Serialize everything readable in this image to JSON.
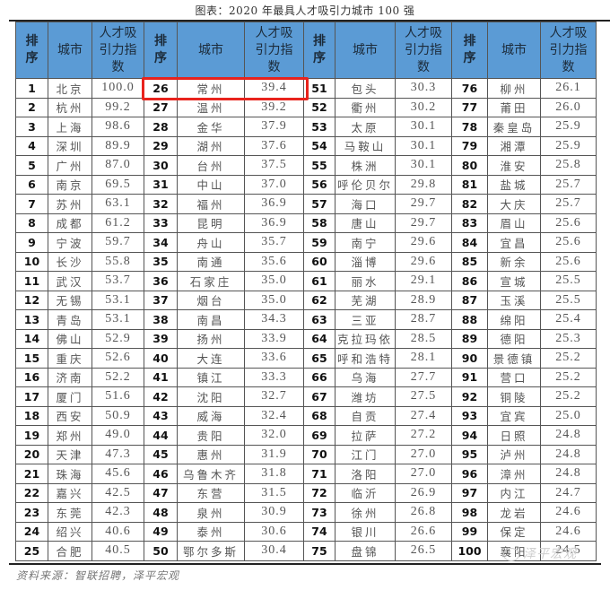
{
  "title": "图表：2020 年最具人才吸引力城市 100 强",
  "headers": {
    "rank": "排序",
    "city": "城市",
    "index": "人才吸引力指数"
  },
  "highlight_rank": 26,
  "highlight_color": "#e8231d",
  "header_color": "#5b9bd5",
  "rows": [
    [
      [
        "1",
        "北京",
        "100.0"
      ],
      [
        "26",
        "常州",
        "39.4"
      ],
      [
        "51",
        "包头",
        "30.3"
      ],
      [
        "76",
        "柳州",
        "26.1"
      ]
    ],
    [
      [
        "2",
        "杭州",
        "99.2"
      ],
      [
        "27",
        "温州",
        "39.2"
      ],
      [
        "52",
        "衢州",
        "30.2"
      ],
      [
        "77",
        "莆田",
        "26.0"
      ]
    ],
    [
      [
        "3",
        "上海",
        "98.6"
      ],
      [
        "28",
        "金华",
        "37.9"
      ],
      [
        "53",
        "太原",
        "30.1"
      ],
      [
        "78",
        "秦皇岛",
        "25.9"
      ]
    ],
    [
      [
        "4",
        "深圳",
        "89.9"
      ],
      [
        "29",
        "湖州",
        "37.6"
      ],
      [
        "54",
        "马鞍山",
        "30.1"
      ],
      [
        "79",
        "湘潭",
        "25.9"
      ]
    ],
    [
      [
        "5",
        "广州",
        "87.0"
      ],
      [
        "30",
        "台州",
        "37.5"
      ],
      [
        "55",
        "株洲",
        "30.1"
      ],
      [
        "80",
        "淮安",
        "25.8"
      ]
    ],
    [
      [
        "6",
        "南京",
        "69.5"
      ],
      [
        "31",
        "中山",
        "37.0"
      ],
      [
        "56",
        "呼伦贝尔",
        "29.8"
      ],
      [
        "81",
        "盐城",
        "25.7"
      ]
    ],
    [
      [
        "7",
        "苏州",
        "63.1"
      ],
      [
        "32",
        "福州",
        "36.9"
      ],
      [
        "57",
        "海口",
        "29.7"
      ],
      [
        "82",
        "大庆",
        "25.7"
      ]
    ],
    [
      [
        "8",
        "成都",
        "61.2"
      ],
      [
        "33",
        "昆明",
        "36.9"
      ],
      [
        "58",
        "唐山",
        "29.7"
      ],
      [
        "83",
        "眉山",
        "25.6"
      ]
    ],
    [
      [
        "9",
        "宁波",
        "59.7"
      ],
      [
        "34",
        "舟山",
        "35.7"
      ],
      [
        "59",
        "南宁",
        "29.6"
      ],
      [
        "84",
        "宜昌",
        "25.6"
      ]
    ],
    [
      [
        "10",
        "长沙",
        "55.8"
      ],
      [
        "35",
        "南通",
        "35.6"
      ],
      [
        "60",
        "淄博",
        "29.6"
      ],
      [
        "85",
        "新余",
        "25.6"
      ]
    ],
    [
      [
        "11",
        "武汉",
        "53.7"
      ],
      [
        "36",
        "石家庄",
        "35.0"
      ],
      [
        "61",
        "丽水",
        "29.1"
      ],
      [
        "86",
        "宣城",
        "25.5"
      ]
    ],
    [
      [
        "12",
        "无锡",
        "53.1"
      ],
      [
        "37",
        "烟台",
        "35.0"
      ],
      [
        "62",
        "芜湖",
        "28.9"
      ],
      [
        "87",
        "玉溪",
        "25.5"
      ]
    ],
    [
      [
        "13",
        "青岛",
        "53.1"
      ],
      [
        "38",
        "南昌",
        "34.3"
      ],
      [
        "63",
        "三亚",
        "28.7"
      ],
      [
        "88",
        "绵阳",
        "25.4"
      ]
    ],
    [
      [
        "14",
        "佛山",
        "52.9"
      ],
      [
        "39",
        "扬州",
        "33.9"
      ],
      [
        "64",
        "克拉玛依",
        "28.5"
      ],
      [
        "89",
        "德阳",
        "25.3"
      ]
    ],
    [
      [
        "15",
        "重庆",
        "52.6"
      ],
      [
        "40",
        "大连",
        "33.6"
      ],
      [
        "65",
        "呼和浩特",
        "28.1"
      ],
      [
        "90",
        "景德镇",
        "25.2"
      ]
    ],
    [
      [
        "16",
        "济南",
        "52.2"
      ],
      [
        "41",
        "镇江",
        "33.3"
      ],
      [
        "66",
        "乌海",
        "27.7"
      ],
      [
        "91",
        "营口",
        "25.2"
      ]
    ],
    [
      [
        "17",
        "厦门",
        "51.6"
      ],
      [
        "42",
        "沈阳",
        "32.7"
      ],
      [
        "67",
        "潍坊",
        "27.5"
      ],
      [
        "92",
        "铜陵",
        "25.2"
      ]
    ],
    [
      [
        "18",
        "西安",
        "50.9"
      ],
      [
        "43",
        "威海",
        "32.4"
      ],
      [
        "68",
        "自贡",
        "27.4"
      ],
      [
        "93",
        "宜宾",
        "25.0"
      ]
    ],
    [
      [
        "19",
        "郑州",
        "49.0"
      ],
      [
        "44",
        "贵阳",
        "32.0"
      ],
      [
        "69",
        "拉萨",
        "27.2"
      ],
      [
        "94",
        "日照",
        "24.8"
      ]
    ],
    [
      [
        "20",
        "天津",
        "47.3"
      ],
      [
        "45",
        "惠州",
        "31.9"
      ],
      [
        "70",
        "江门",
        "27.0"
      ],
      [
        "95",
        "泸州",
        "24.8"
      ]
    ],
    [
      [
        "21",
        "珠海",
        "45.6"
      ],
      [
        "46",
        "乌鲁木齐",
        "31.8"
      ],
      [
        "71",
        "洛阳",
        "27.0"
      ],
      [
        "96",
        "漳州",
        "24.8"
      ]
    ],
    [
      [
        "22",
        "嘉兴",
        "42.5"
      ],
      [
        "47",
        "东营",
        "31.5"
      ],
      [
        "72",
        "临沂",
        "26.9"
      ],
      [
        "97",
        "内江",
        "24.7"
      ]
    ],
    [
      [
        "23",
        "东莞",
        "42.3"
      ],
      [
        "48",
        "泉州",
        "30.9"
      ],
      [
        "73",
        "徐州",
        "26.8"
      ],
      [
        "98",
        "龙岩",
        "24.6"
      ]
    ],
    [
      [
        "24",
        "绍兴",
        "40.6"
      ],
      [
        "49",
        "泰州",
        "30.6"
      ],
      [
        "74",
        "银川",
        "26.6"
      ],
      [
        "99",
        "保定",
        "24.6"
      ]
    ],
    [
      [
        "25",
        "合肥",
        "40.5"
      ],
      [
        "50",
        "鄂尔多斯",
        "30.4"
      ],
      [
        "75",
        "盘锦",
        "26.5"
      ],
      [
        "100",
        "襄阳",
        "24.5"
      ]
    ]
  ],
  "source": "资料来源：智联招聘，泽平宏观",
  "watermark": "泽平宏观",
  "watermark_icon": "wechat-icon"
}
